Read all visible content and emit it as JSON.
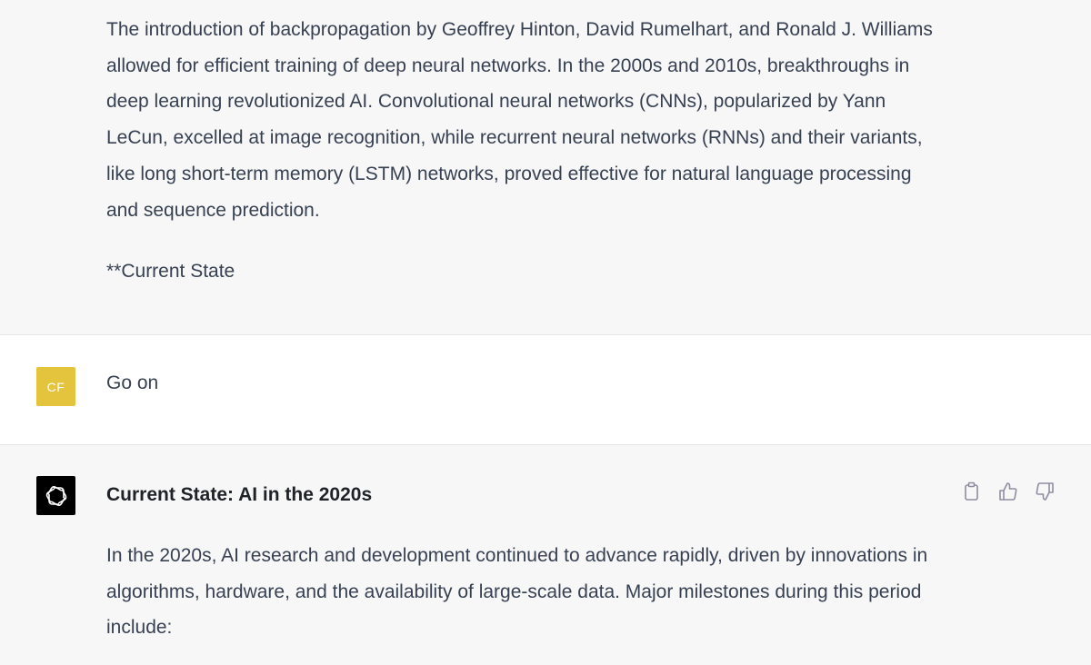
{
  "previous_response": {
    "paragraph": "The introduction of backpropagation by Geoffrey Hinton, David Rumelhart, and Ronald J. Williams allowed for efficient training of deep neural networks. In the 2000s and 2010s, breakthroughs in deep learning revolutionized AI. Convolutional neural networks (CNNs), popularized by Yann LeCun, excelled at image recognition, while recurrent neural networks (RNNs) and their variants, like long short-term memory (LSTM) networks, proved effective for natural language processing and sequence prediction.",
    "trailing_text": "**Current State"
  },
  "user_message": {
    "avatar_initials": "CF",
    "avatar_color": "#e4c33d",
    "text": "Go on"
  },
  "assistant_message": {
    "avatar_icon": "openai-logo-icon",
    "heading": "Current State: AI in the 2020s",
    "paragraph": "In the 2020s, AI research and development continued to advance rapidly, driven by innovations in algorithms, hardware, and the availability of large-scale data. Major milestones during this period include:",
    "actions": [
      "copy-icon",
      "thumbs-up-icon",
      "thumbs-down-icon"
    ]
  }
}
